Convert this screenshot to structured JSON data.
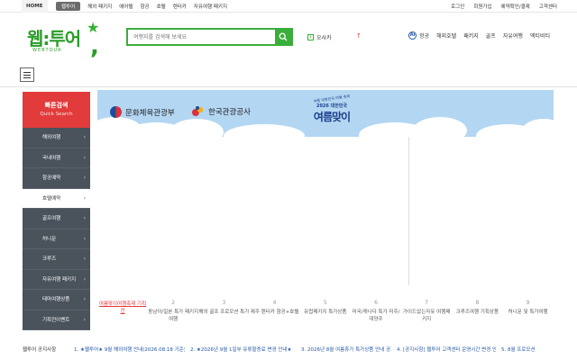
{
  "topbar": {
    "home": "HOME",
    "left_links": [
      "웹투어",
      "해외 패키지",
      "에어텔",
      "항공",
      "호텔",
      "렌터카",
      "자유여행 패키지"
    ],
    "right_links": [
      "로그인",
      "회원가입",
      "예약확인/결제",
      "고객센터"
    ]
  },
  "logo": {
    "word": "웹:투어",
    "sub": "WEBTOUR"
  },
  "search": {
    "placeholder": "여행지를 검색해 보세요"
  },
  "rank": {
    "num": "1",
    "label": "오사카"
  },
  "gnb_right": {
    "ai": "Ai",
    "links": [
      "항공",
      "해외호텔",
      "패키지",
      "골프",
      "자유여행",
      "액티비티"
    ]
  },
  "quick": {
    "title": "빠른검색",
    "subtitle": "Quick Search",
    "items": [
      "해외여행",
      "국내여행",
      "항공예약",
      "호텔예약",
      "골프여행",
      "허니문",
      "크루즈",
      "자유여행 패키지",
      "테마여행상품",
      "기획전이벤트"
    ],
    "selected_index": 3
  },
  "banner": {
    "org1": "문화체육관광부",
    "org2": "한국관광공사",
    "campaign_top": "여름 대한민국 여행 축제",
    "campaign_year": "2026 대한민국",
    "campaign_title": "여름맞이"
  },
  "tabs": [
    {
      "num": "",
      "label": "여름맞이여행축제 기획전"
    },
    {
      "num": "2",
      "label": "동남아/일본 특가 패키지여행"
    },
    {
      "num": "3",
      "label": "해외 골프 프로모션 특가"
    },
    {
      "num": "4",
      "label": "제주 렌터카 항공+호텔"
    },
    {
      "num": "5",
      "label": "유럽패키지 특가상품"
    },
    {
      "num": "6",
      "label": "미국/캐나다 특가 미주/대양주"
    },
    {
      "num": "7",
      "label": "가이드없는자유 여행패키지"
    },
    {
      "num": "8",
      "label": "크루즈여행 기획상품"
    },
    {
      "num": "9",
      "label": "허니문 및 특가여행"
    }
  ],
  "notice": {
    "title": "웹투어 공지사항",
    "items": [
      "1. ★웹투어★ 9월 해외여행 안내(2026.08.18 기준)",
      "2. ★2026년 9월 1일부 유류할증료 변경 안내★",
      "3. 2026년 8월 여름휴가 특가상품 안내 공지",
      "4. [공지사항] 웹투어 고객센터 운영시간 변경 안내",
      "5. 8월 프로모션"
    ]
  },
  "colors": {
    "brand_green": "#3aae3a",
    "quick_red": "#e23b3b",
    "quick_bg": "#444b55",
    "banner_sky": "#b3d6f2",
    "link_blue": "#2456a8"
  }
}
